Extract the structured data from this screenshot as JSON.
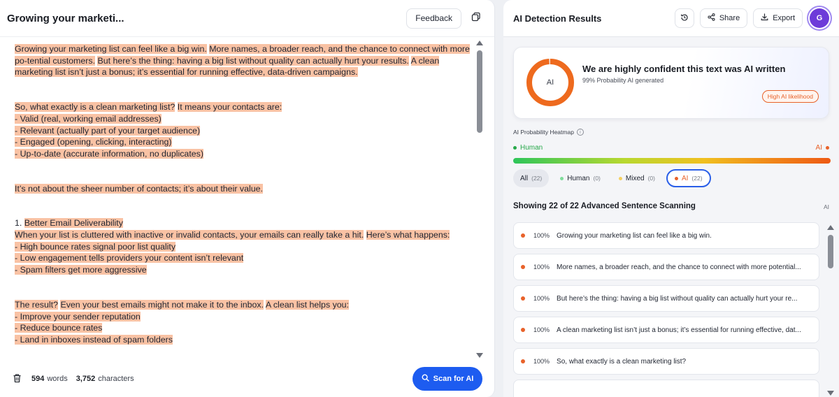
{
  "left": {
    "title": "Growing your marketi...",
    "feedback_label": "Feedback",
    "copy_icon": "copy-icon",
    "paragraphs": [
      {
        "segments": [
          {
            "t": "Growing your marketing list can feel like a big win.",
            "h": true
          },
          {
            "t": " ",
            "h": false
          },
          {
            "t": "More names, a broader reach, and the chance to connect with more po-tential customers.",
            "h": true
          },
          {
            "t": " ",
            "h": false
          },
          {
            "t": "But here’s the thing: having a big list without quality can actually hurt your results.",
            "h": true
          },
          {
            "t": " ",
            "h": false
          },
          {
            "t": "A clean marketing list isn’t just a bonus; it’s essential for running effective, data-driven campaigns.",
            "h": true
          }
        ]
      },
      {
        "segments": [
          {
            "t": "So, what exactly is a clean marketing list?",
            "h": true
          },
          {
            "t": " ",
            "h": false
          },
          {
            "t": "It means your contacts are:",
            "h": true
          }
        ],
        "lines": [
          "- Valid (real, working email addresses)",
          "- Relevant (actually part of your target audience)",
          "- Engaged (opening, clicking, interacting)",
          "- Up-to-date (accurate information, no duplicates)"
        ]
      },
      {
        "segments": [
          {
            "t": "It’s not about the sheer number of contacts; it’s about their value.",
            "h": true
          }
        ]
      },
      {
        "segments": [
          {
            "t": "1. ",
            "h": false
          },
          {
            "t": "Better Email Deliverability",
            "h": true
          }
        ],
        "lines2": [
          {
            "parts": [
              {
                "t": "When your list is cluttered with inactive or invalid contacts, your emails can really take a hit.",
                "h": true
              },
              {
                "t": " ",
                "h": false
              },
              {
                "t": "Here’s what happens:",
                "h": true
              }
            ]
          }
        ],
        "lines": [
          "- High bounce rates signal poor list quality",
          "- Low engagement tells providers your content isn’t relevant",
          "- Spam filters get more aggressive"
        ]
      },
      {
        "segments": [
          {
            "t": "The result?",
            "h": true
          },
          {
            "t": " ",
            "h": false
          },
          {
            "t": "Even your best emails might not make it to the inbox.",
            "h": true
          },
          {
            "t": " ",
            "h": false
          },
          {
            "t": "A clean list helps you:",
            "h": true
          }
        ],
        "lines": [
          "- Improve your sender reputation",
          "- Reduce bounce rates",
          "- Land in inboxes instead of spam folders"
        ]
      }
    ],
    "footer": {
      "word_count": "594",
      "words_label": "words",
      "char_count": "3,752",
      "chars_label": "characters",
      "scan_label": "Scan for AI"
    }
  },
  "right": {
    "title": "AI Detection Results",
    "share_label": "Share",
    "export_label": "Export",
    "avatar_initial": "G",
    "result": {
      "donut_label": "AI",
      "headline": "We are highly confident this text was AI written",
      "sub": "99% Probability AI generated",
      "badge": "High AI likelihood",
      "ai_probability": 0.99
    },
    "heatmap": {
      "title": "AI Probability Heatmap",
      "human_label": "Human",
      "ai_label": "AI"
    },
    "filters": [
      {
        "label": "All",
        "count": "(22)"
      },
      {
        "label": "Human",
        "count": "(0)"
      },
      {
        "label": "Mixed",
        "count": "(0)"
      },
      {
        "label": "AI",
        "count": "(22)"
      }
    ],
    "scan_title": "Showing 22 of 22 Advanced Sentence Scanning",
    "scan_ai": "AI",
    "sentences": [
      {
        "pct": "100%",
        "text": "Growing your marketing list can feel like a big win."
      },
      {
        "pct": "100%",
        "text": "More names, a broader reach, and the chance to connect with more potential..."
      },
      {
        "pct": "100%",
        "text": "But here’s the thing: having a big list without quality can actually hurt your re..."
      },
      {
        "pct": "100%",
        "text": "A clean marketing list isn’t just a bonus; it’s essential for running effective, dat..."
      },
      {
        "pct": "100%",
        "text": "So, what exactly is a clean marketing list?"
      },
      {
        "pct": "",
        "text": ""
      }
    ]
  },
  "colors": {
    "highlight": "#f9c2a4",
    "accent_blue": "#1d5cf0",
    "ai_orange": "#e8622a",
    "human_green": "#27a84a",
    "mixed_yellow": "#f0c020"
  }
}
